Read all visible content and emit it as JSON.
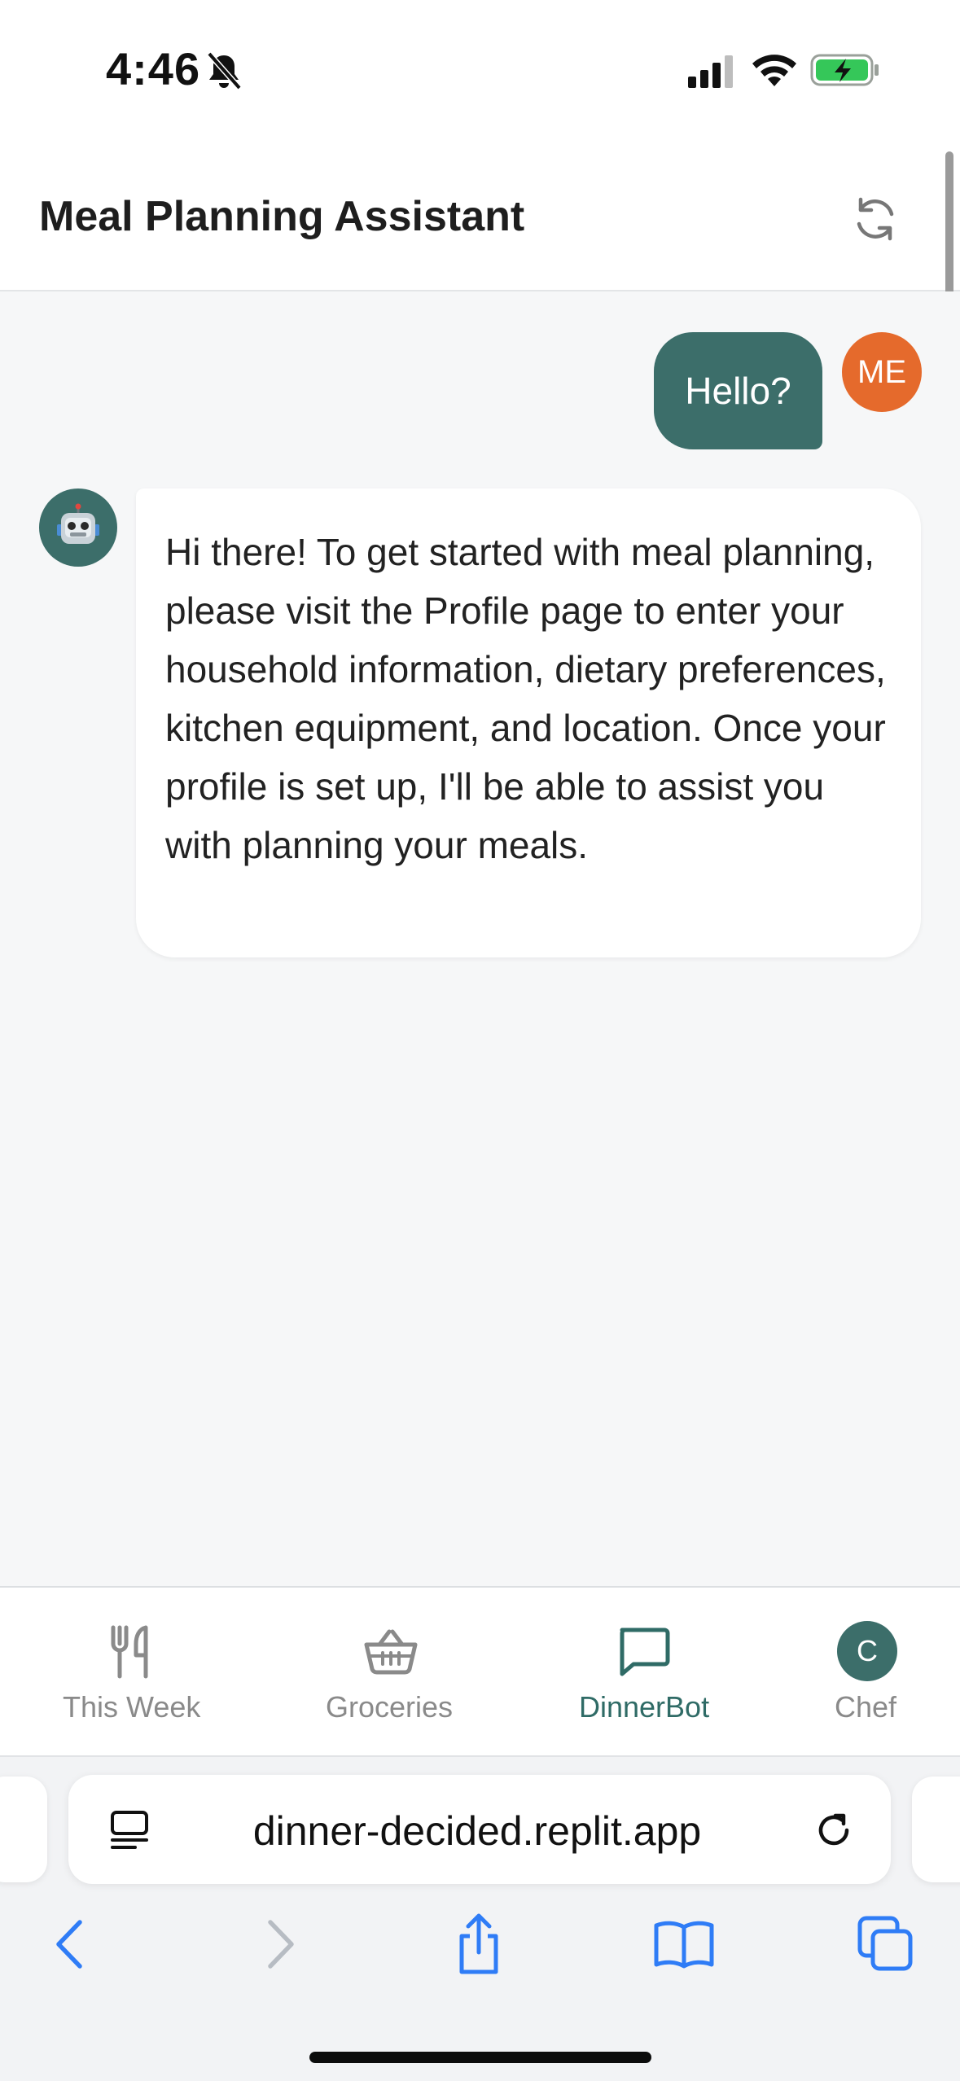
{
  "status_bar": {
    "time": "4:46",
    "icons": [
      "bell-off-icon",
      "signal-icon",
      "wifi-icon",
      "battery-charging-icon"
    ]
  },
  "header": {
    "title": "Meal Planning Assistant",
    "refresh_icon": "refresh-icon"
  },
  "chat": {
    "messages": [
      {
        "sender": "user",
        "avatar_text": "ME",
        "text": "Hello?"
      },
      {
        "sender": "bot",
        "avatar_icon": "robot-icon",
        "text": "Hi there! To get started with meal planning, please visit the Profile page to enter your household information, dietary preferences, kitchen equipment, and location. Once your profile is set up, I'll be able to assist you with planning your meals."
      }
    ]
  },
  "tabs": [
    {
      "label": "This Week",
      "icon": "fork-knife-icon",
      "active": false
    },
    {
      "label": "Groceries",
      "icon": "basket-icon",
      "active": false
    },
    {
      "label": "DinnerBot",
      "icon": "chat-bubble-icon",
      "active": true
    },
    {
      "label": "Chef",
      "icon": "avatar",
      "avatar_text": "C",
      "active": false
    }
  ],
  "browser": {
    "url": "dinner-decided.replit.app",
    "toolbar": [
      "back-icon",
      "forward-icon",
      "share-icon",
      "bookmarks-icon",
      "tabs-icon"
    ]
  },
  "colors": {
    "accent": "#3c6e6a",
    "user_avatar": "#e56a2c",
    "active_tab": "#2f6b66",
    "inactive_tab": "#8a8a8a",
    "safari_blue": "#2f7cf6"
  }
}
